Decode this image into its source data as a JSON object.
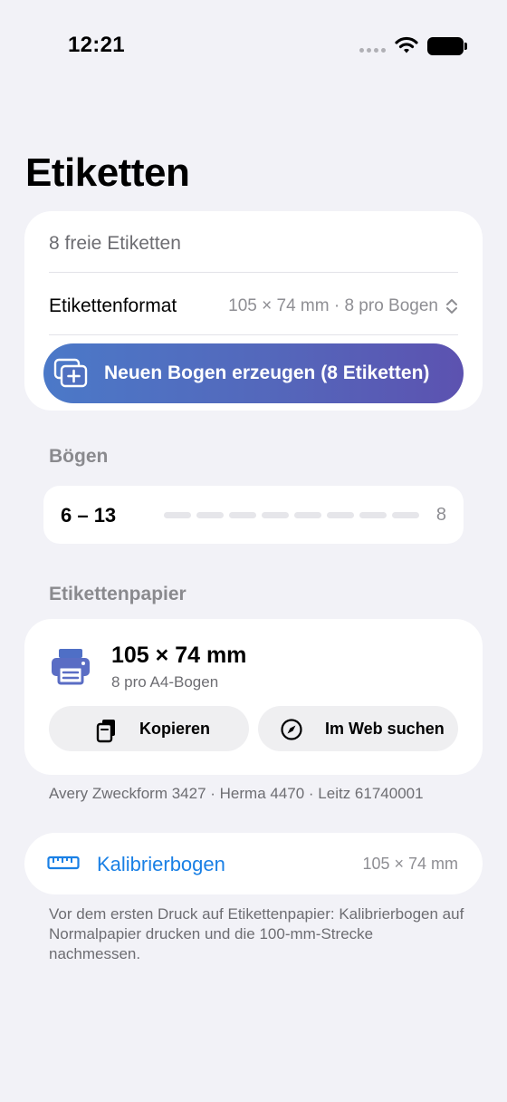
{
  "status_bar": {
    "time": "12:21"
  },
  "page": {
    "title": "Etiketten"
  },
  "main_card": {
    "free_labels": "8 freie Etiketten",
    "format_label": "Etikettenformat",
    "format_value": "105 × 74 mm · 8 pro Bogen",
    "create_button_label": "Neuen Bogen erzeugen (8 Etiketten)",
    "button_gradient": [
      "#4b79c8",
      "#5c52b0"
    ]
  },
  "sheets": {
    "header": "Bögen",
    "range": "6 – 13",
    "count": "8"
  },
  "paper": {
    "header": "Etikettenpapier",
    "size": "105 × 74 mm",
    "per_sheet": "8 pro A4-Bogen",
    "copy_label": "Kopieren",
    "web_label": "Im Web suchen",
    "compatible": "Avery Zweckform 3427 · Herma 4470 · Leitz 61740001"
  },
  "calibration": {
    "label": "Kalibrierbogen",
    "size": "105 × 74 mm",
    "note": "Vor dem ersten Druck auf Etikettenpapier: Kalibrierbogen auf Normalpapier drucken und die 100-mm-Strecke nachmessen.",
    "accent": "#1a80e5"
  },
  "icons": {
    "signal": "cellular-signal-icon",
    "wifi": "wifi-icon",
    "battery": "battery-icon",
    "updown": "chevron-up-down-icon",
    "create": "add-sheet-icon",
    "printer": "printer-icon",
    "copy": "copy-icon",
    "web": "compass-icon",
    "ruler": "ruler-icon"
  }
}
